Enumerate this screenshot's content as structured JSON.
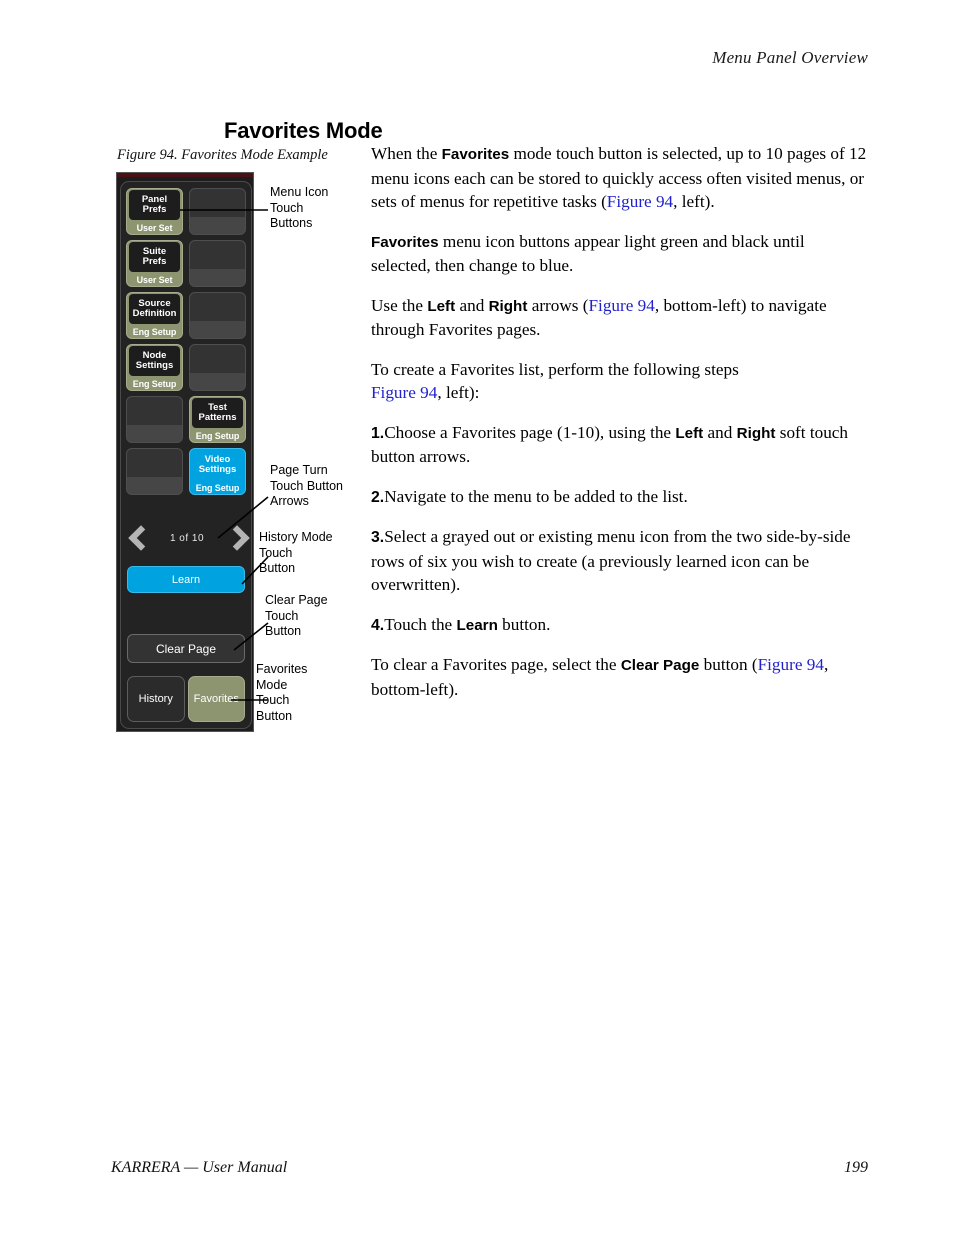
{
  "header": {
    "running_head": "Menu Panel Overview"
  },
  "section": {
    "title": "Favorites Mode"
  },
  "figure": {
    "caption": "Figure 94.  Favorites Mode Example",
    "panel": {
      "menu_buttons": [
        {
          "line1": "Panel",
          "line2": "Prefs",
          "category": "User Set",
          "state": "green"
        },
        {
          "line1": "",
          "line2": "",
          "category": "",
          "state": "empty"
        },
        {
          "line1": "Suite",
          "line2": "Prefs",
          "category": "User Set",
          "state": "green"
        },
        {
          "line1": "",
          "line2": "",
          "category": "",
          "state": "empty"
        },
        {
          "line1": "Source",
          "line2": "Definition",
          "category": "Eng  Setup",
          "state": "green"
        },
        {
          "line1": "",
          "line2": "",
          "category": "",
          "state": "empty"
        },
        {
          "line1": "Node",
          "line2": "Settings",
          "category": "Eng  Setup",
          "state": "green"
        },
        {
          "line1": "",
          "line2": "",
          "category": "",
          "state": "empty"
        },
        {
          "line1": "",
          "line2": "",
          "category": "",
          "state": "empty"
        },
        {
          "line1": "Test",
          "line2": "Patterns",
          "category": "Eng  Setup",
          "state": "green"
        },
        {
          "line1": "",
          "line2": "",
          "category": "",
          "state": "empty"
        },
        {
          "line1": "Video",
          "line2": "Settings",
          "category": "Eng  Setup",
          "state": "blue"
        }
      ],
      "page_indicator": "1   of  10",
      "learn_label": "Learn",
      "clear_page_label": "Clear Page",
      "tabs": [
        {
          "label": "History",
          "state": "inactive"
        },
        {
          "label": "Favorites",
          "state": "active"
        }
      ]
    },
    "callouts": {
      "menu_icon": "Menu Icon\nTouch\nButtons",
      "page_turn": "Page Turn\nTouch Button\nArrows",
      "history_mode": "History Mode\nTouch\nButton",
      "clear_page": "Clear Page\nTouch\nButton",
      "favorites_mode": "Favorites\nMode\nTouch\nButton"
    }
  },
  "body": {
    "p1_a": "When the ",
    "p1_b": "Favorites",
    "p1_c": " mode touch button is selected, up to 10 pages of 12 menu icons each can be stored to quickly access often visited menus, or sets of menus for repetitive tasks (",
    "p1_xref": "Figure 94",
    "p1_d": ", left).",
    "p2_a": "Favorites",
    "p2_b": " menu icon buttons appear light green and black until selected, then change to blue.",
    "p3_a": "Use the ",
    "p3_b": "Left",
    "p3_c": " and ",
    "p3_d": "Right",
    "p3_e": " arrows (",
    "p3_xref": "Figure 94",
    "p3_f": ", bottom-left) to navigate through Favorites pages.",
    "p4_a": "To create a Favorites list, perform the following steps",
    "p4_xref": "Figure 94",
    "p4_b": ", left):",
    "s1_num": "1.",
    "s1_a": "Choose a Favorites page (1-10), using the ",
    "s1_b": "Left",
    "s1_c": " and ",
    "s1_d": "Right",
    "s1_e": " soft touch button arrows.",
    "s2_num": "2.",
    "s2_a": "Navigate to the menu to be added to the list.",
    "s3_num": "3.",
    "s3_a": "Select a grayed out or existing menu icon from the two side-by-side rows of six you wish to create (a previously learned icon can be overwritten).",
    "s4_num": "4.",
    "s4_a": "Touch the ",
    "s4_b": "Learn",
    "s4_c": " button.",
    "p5_a": "To clear a Favorites page, select the ",
    "p5_b": "Clear Page",
    "p5_c": " button (",
    "p5_xref": "Figure 94",
    "p5_d": ", bottom-left)."
  },
  "footer": {
    "left": "KARRERA  —  User Manual",
    "page_number": "199"
  }
}
